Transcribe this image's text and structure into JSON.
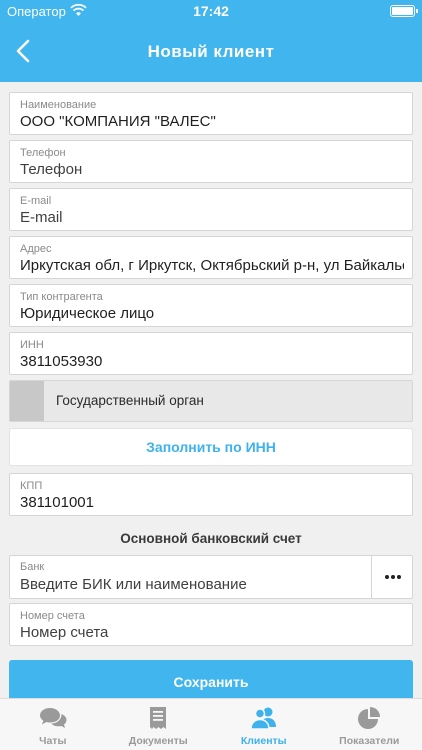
{
  "status_bar": {
    "carrier": "Оператор",
    "time": "17:42"
  },
  "nav": {
    "title": "Новый клиент",
    "back_icon": "chevron-left-icon"
  },
  "form": {
    "name": {
      "label": "Наименование",
      "value": "ООО \"КОМПАНИЯ \"ВАЛЕС\""
    },
    "phone": {
      "label": "Телефон",
      "placeholder": "Телефон"
    },
    "email": {
      "label": "E-mail",
      "placeholder": "E-mail"
    },
    "address": {
      "label": "Адрес",
      "value": "Иркутская обл, г Иркутск, Октябрьский р-н, ул Байкальская"
    },
    "counterparty_type": {
      "label": "Тип контрагента",
      "value": "Юридическое лицо"
    },
    "inn": {
      "label": "ИНН",
      "value": "3811053930"
    },
    "government_toggle": {
      "label": "Государственный орган",
      "checked": false
    },
    "fill_by_inn_label": "Заполнить по ИНН",
    "kpp": {
      "label": "КПП",
      "value": "381101001"
    },
    "bank_section_title": "Основной банковский счет",
    "bank": {
      "label": "Банк",
      "placeholder": "Введите БИК или наименование",
      "more_icon": "more-horizontal-icon"
    },
    "account_number": {
      "label": "Номер счета",
      "placeholder": "Номер счета"
    },
    "save_label": "Сохранить"
  },
  "tabs": [
    {
      "label": "Чаты",
      "icon": "chat-icon",
      "active": false
    },
    {
      "label": "Документы",
      "icon": "document-icon",
      "active": false
    },
    {
      "label": "Клиенты",
      "icon": "clients-icon",
      "active": true
    },
    {
      "label": "Показатели",
      "icon": "pie-chart-icon",
      "active": false
    }
  ],
  "colors": {
    "accent": "#40b5ee",
    "background": "#f0f0f0",
    "tab_inactive": "#9a9a9a"
  }
}
